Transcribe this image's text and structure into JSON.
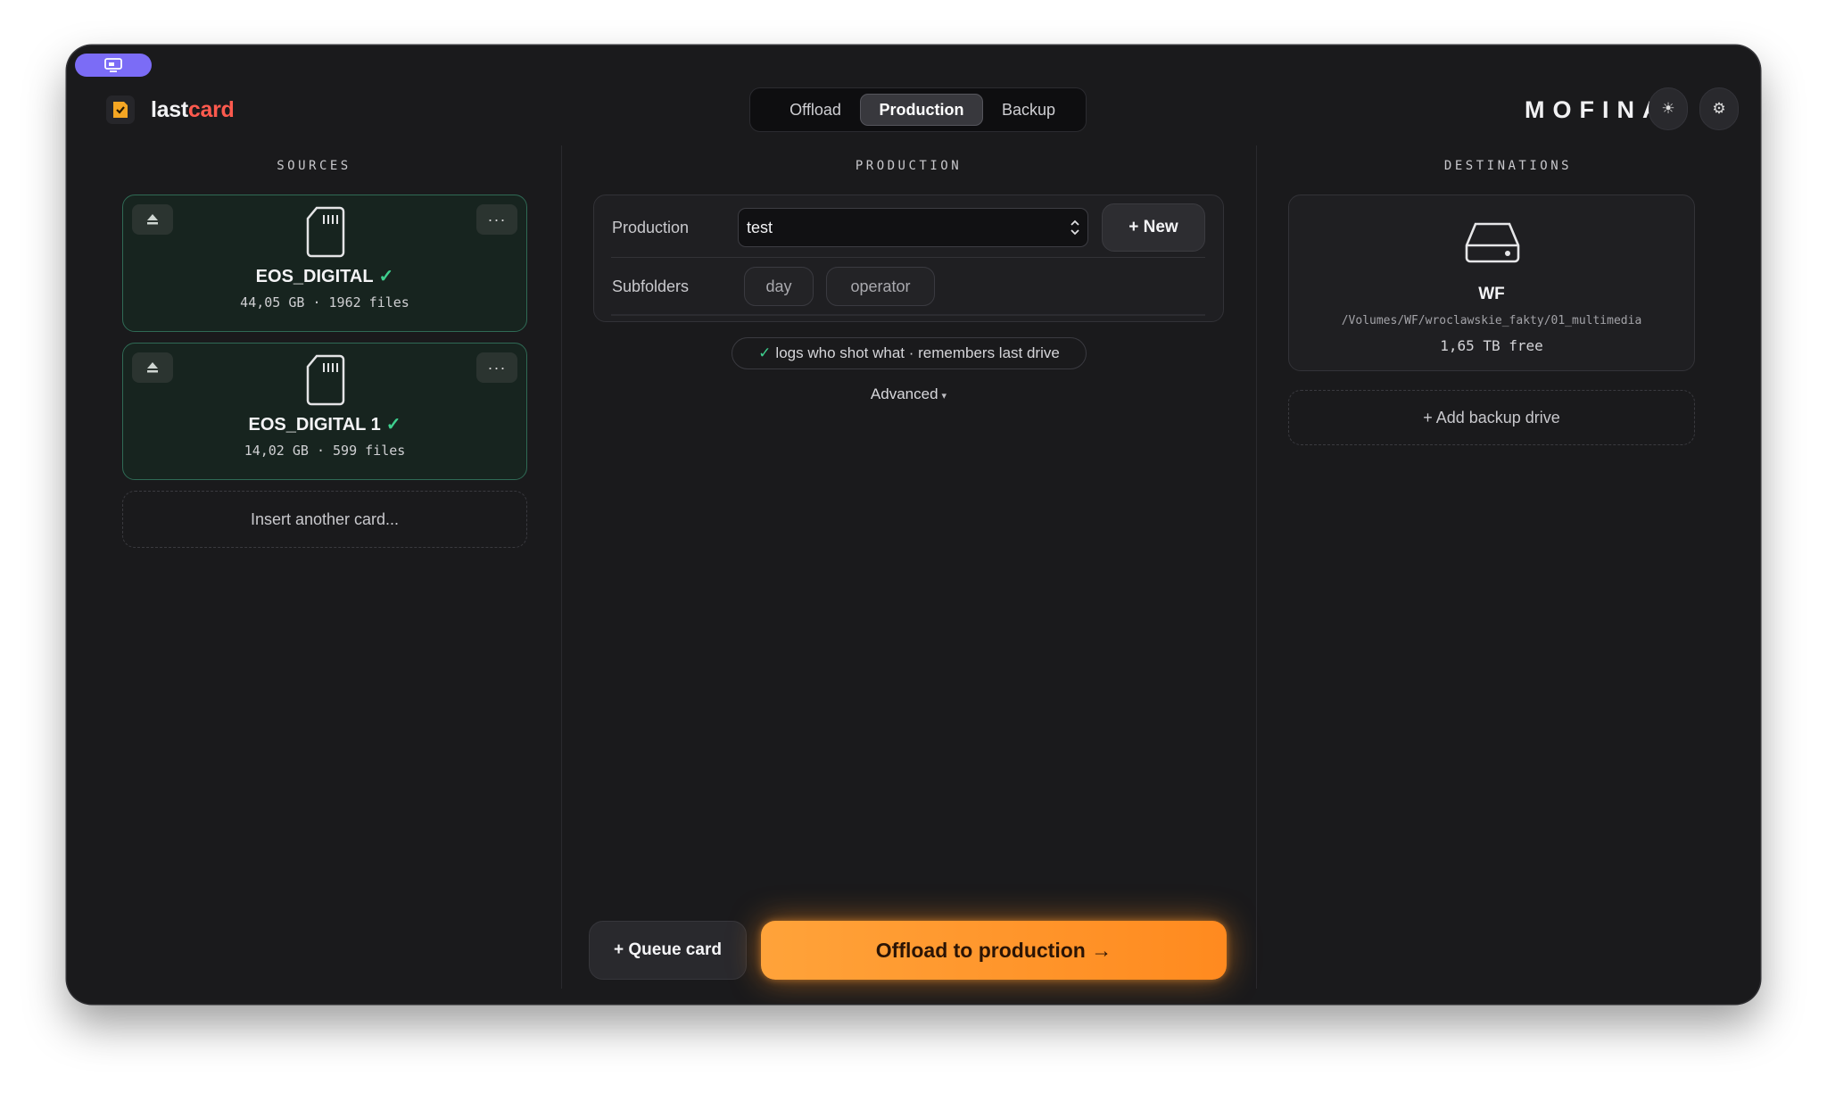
{
  "app": {
    "logo_prefix": "last",
    "logo_suffix": "card",
    "brand": "MOFINA"
  },
  "tabs": [
    {
      "label": "Offload",
      "active": false
    },
    {
      "label": "Production",
      "active": true
    },
    {
      "label": "Backup",
      "active": false
    }
  ],
  "sources": {
    "title": "SOURCES",
    "cards": [
      {
        "name": "EOS_DIGITAL",
        "meta": "44,05 GB · 1962 files",
        "check": "✓"
      },
      {
        "name": "EOS_DIGITAL 1",
        "meta": "14,02 GB · 599 files",
        "check": "✓"
      }
    ],
    "insert_label": "Insert another card..."
  },
  "production": {
    "title": "PRODUCTION",
    "production_label": "Production",
    "production_value": "test",
    "new_label": "+ New",
    "subfolders_label": "Subfolders",
    "subfolders": [
      "day",
      "operator"
    ],
    "info_check": "✓",
    "info": "logs who shot what · remembers last drive",
    "advanced_label": "Advanced",
    "advanced_caret": "▾",
    "queue_label": "+ Queue card",
    "offload_label": "Offload to production →"
  },
  "destinations": {
    "title": "DESTINATIONS",
    "drive": {
      "name": "WF",
      "path": "/Volumes/WF/wroclawskie_fakty/01_multimedia",
      "free": "1,65 TB free"
    },
    "add_label": "+ Add backup drive"
  },
  "icons": {
    "theme": "☀",
    "settings": "⚙",
    "more": "···"
  },
  "colors": {
    "accent_orange": "#ff9a2e",
    "success_green": "#3ecf8e",
    "logo_red": "#ff5a4e",
    "tag_purple": "#7b6cf6",
    "window_bg": "#1a1a1c"
  }
}
